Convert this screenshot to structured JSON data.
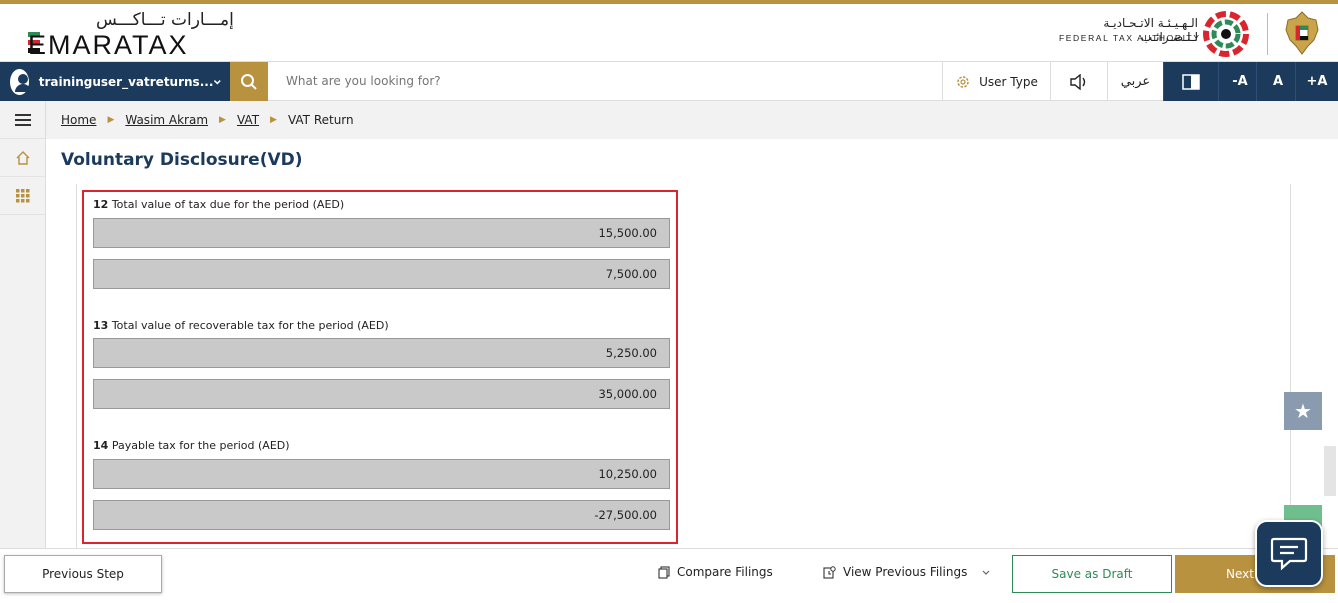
{
  "header": {
    "logo_ar": "إمـــارات تـــاكـــس",
    "logo_en": "EMARATAX",
    "authority_ar": "الـهـيـئـة الاتـحـاديـة لـلـضـرائـب",
    "authority_en": "FEDERAL TAX AUTHORITY"
  },
  "navbar": {
    "username": "traininguser_vatreturns...",
    "search_placeholder": "What are you looking for?",
    "user_type_label": "User Type",
    "arabic_label": "عربي",
    "font_decrease": "-A",
    "font_normal": "A",
    "font_increase": "+A"
  },
  "breadcrumb": [
    "Home",
    "Wasim Akram",
    "VAT",
    "VAT Return"
  ],
  "page": {
    "title": "Voluntary Disclosure(VD)"
  },
  "fields": [
    {
      "number": "12",
      "label": "Total value of tax due for the period (AED)",
      "values": [
        "15,500.00",
        "7,500.00"
      ]
    },
    {
      "number": "13",
      "label": "Total value of recoverable tax for the period (AED)",
      "values": [
        "5,250.00",
        "35,000.00"
      ]
    },
    {
      "number": "14",
      "label": "Payable tax for the period (AED)",
      "values": [
        "10,250.00",
        "-27,500.00"
      ]
    }
  ],
  "footer": {
    "previous_step": "Previous Step",
    "compare_filings": "Compare Filings",
    "view_previous_filings": "View Previous Filings",
    "save_as_draft": "Save as Draft",
    "next": "Next"
  },
  "colors": {
    "navy": "#1b3a5c",
    "gold": "#b8923e",
    "highlight_red": "#d9262e",
    "green": "#2e8b57"
  }
}
